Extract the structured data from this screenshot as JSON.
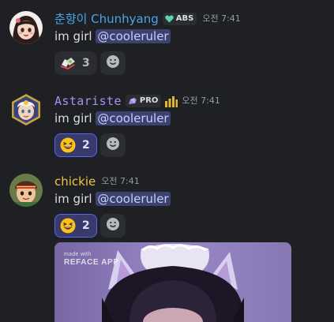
{
  "messages": [
    {
      "username": "춘향이 Chunhyang",
      "username_color": "#4ba3e9",
      "tag": {
        "label": "ABS",
        "icon": "heart-icon"
      },
      "timestamp": "오전 7:41",
      "text": "im girl",
      "mention": "@cooleruler",
      "reactions": [
        {
          "emoji": "flying-money-icon",
          "count": "3",
          "me": false
        }
      ]
    },
    {
      "username": "Astariste",
      "username_color": "#a491f2",
      "tag": {
        "label": "PRO",
        "icon": "crystal-icon"
      },
      "extra_icon": "signal-bars-icon",
      "timestamp": "오전 7:41",
      "text": "im girl",
      "mention": "@cooleruler",
      "reactions": [
        {
          "emoji": "laughing-face-icon",
          "count": "2",
          "me": true
        }
      ]
    },
    {
      "username": "chickie",
      "username_color": "#f0c340",
      "timestamp": "오전 7:41",
      "text": "im girl",
      "mention": "@cooleruler",
      "reactions": [
        {
          "emoji": "laughing-face-icon",
          "count": "2",
          "me": true
        }
      ],
      "attachment": {
        "type": "image",
        "watermark_line1": "made with",
        "watermark_line2": "REFACE APP"
      }
    }
  ],
  "colors": {
    "background": "#1f2024",
    "mention_bg": "#3c4270",
    "reaction_me_border": "#5865f2"
  }
}
